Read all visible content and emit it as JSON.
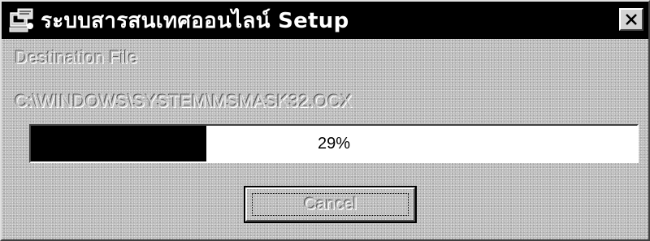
{
  "window": {
    "title": "ระบบสารสนเทศออนไลน์ Setup",
    "icon": "setup-installer-icon",
    "close_icon": "close-icon"
  },
  "content": {
    "destination_label": "Destination File",
    "destination_path": "C:\\WINDOWS\\SYSTEM\\MSMASK32.OCX"
  },
  "progress": {
    "percent": 29,
    "label": "29%"
  },
  "buttons": {
    "cancel_label": "Cancel"
  },
  "colors": {
    "titlebar": "#000000",
    "progress_fill": "#000000",
    "face": "#c0c0c0"
  }
}
